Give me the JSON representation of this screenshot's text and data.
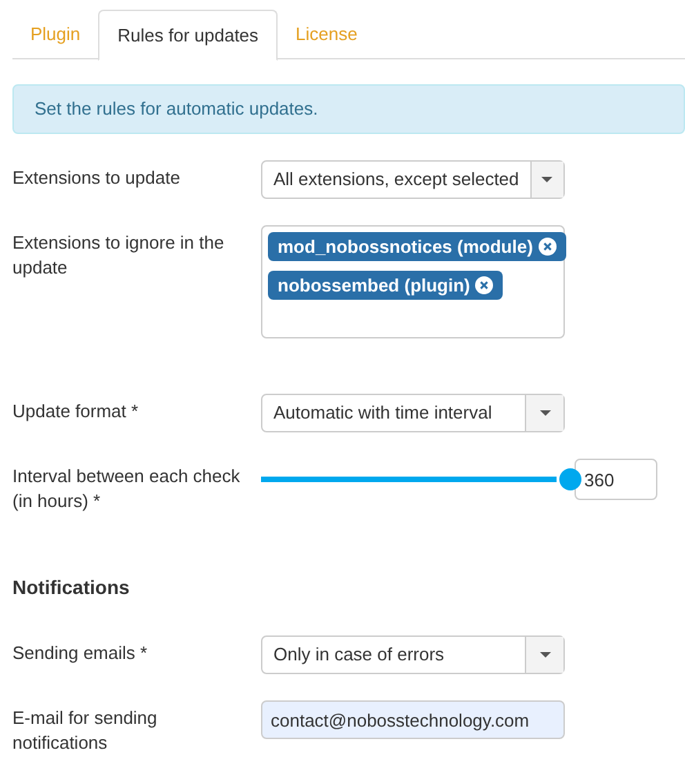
{
  "tabs": [
    {
      "label": "Plugin",
      "selected": false
    },
    {
      "label": "Rules for updates",
      "selected": true
    },
    {
      "label": "License",
      "selected": false
    }
  ],
  "alert": "Set the rules for automatic updates.",
  "fields": [
    {
      "kind": "select",
      "label": "Extensions to update",
      "value": "All extensions, except selected"
    },
    {
      "kind": "tags",
      "label": "Extensions to ignore in the update",
      "tags": [
        "mod_nobossnotices (module)",
        "nobossembed (plugin)"
      ]
    },
    {
      "kind": "select",
      "label": "Update format *",
      "value": "Automatic with time interval"
    },
    {
      "kind": "slider",
      "label": "Interval between each check (in hours) *",
      "level": 1,
      "value": "360"
    },
    {
      "kind": "heading",
      "label": "Notifications"
    },
    {
      "kind": "select",
      "label": "Sending emails *",
      "value": "Only in case of errors"
    },
    {
      "kind": "email",
      "label": "E-mail for sending notifications",
      "value": "contact@nobosstechnology.com"
    }
  ]
}
